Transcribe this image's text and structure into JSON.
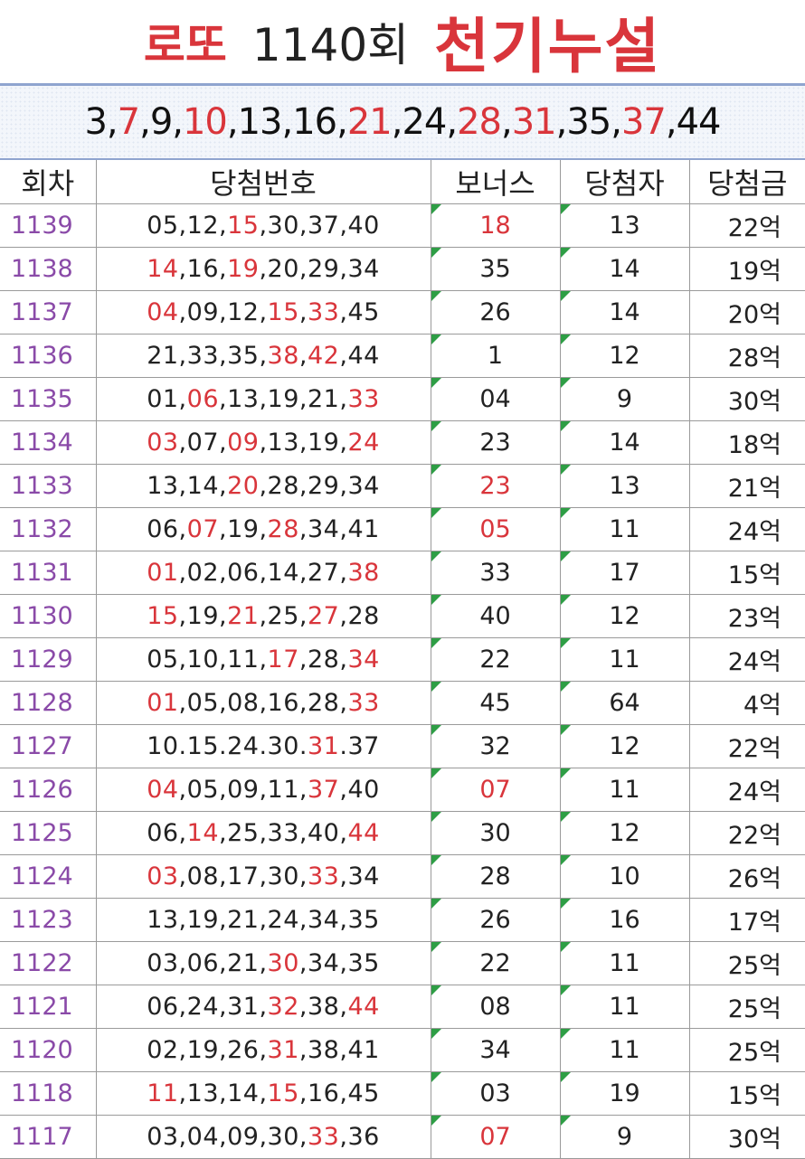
{
  "header": {
    "lotto_label": "로또",
    "round_label": "1140회",
    "secret_label": "천기누설"
  },
  "prediction": {
    "numbers": [
      {
        "n": "3",
        "hot": false
      },
      {
        "n": "7",
        "hot": true
      },
      {
        "n": "9",
        "hot": false
      },
      {
        "n": "10",
        "hot": true
      },
      {
        "n": "13",
        "hot": false
      },
      {
        "n": "16",
        "hot": false
      },
      {
        "n": "21",
        "hot": true
      },
      {
        "n": "24",
        "hot": false
      },
      {
        "n": "28",
        "hot": true
      },
      {
        "n": "31",
        "hot": true
      },
      {
        "n": "35",
        "hot": false
      },
      {
        "n": "37",
        "hot": true
      },
      {
        "n": "44",
        "hot": false
      }
    ],
    "separator": ","
  },
  "table": {
    "columns": [
      "회차",
      "당첨번호",
      "보너스",
      "당첨자",
      "당첨금"
    ],
    "colors": {
      "highlight": "#d9353b",
      "round": "#8a4aa8",
      "flag": "#2e9e45"
    },
    "rows": [
      {
        "round": "1139",
        "nums": [
          "05",
          "12",
          "15",
          "30",
          "37",
          "40"
        ],
        "hot": [
          2
        ],
        "sep": ",",
        "bonus": "18",
        "bonus_hot": true,
        "winners": "13",
        "prize": "22억"
      },
      {
        "round": "1138",
        "nums": [
          "14",
          "16",
          "19",
          "20",
          "29",
          "34"
        ],
        "hot": [
          0,
          2
        ],
        "sep": ",",
        "bonus": "35",
        "bonus_hot": false,
        "winners": "14",
        "prize": "19억"
      },
      {
        "round": "1137",
        "nums": [
          "04",
          "09",
          "12",
          "15",
          "33",
          "45"
        ],
        "hot": [
          0,
          3,
          4
        ],
        "sep": ",",
        "bonus": "26",
        "bonus_hot": false,
        "winners": "14",
        "prize": "20억"
      },
      {
        "round": "1136",
        "nums": [
          "21",
          "33",
          "35",
          "38",
          "42",
          "44"
        ],
        "hot": [
          3,
          4
        ],
        "sep": ",",
        "bonus": "1",
        "bonus_hot": false,
        "winners": "12",
        "prize": "28억"
      },
      {
        "round": "1135",
        "nums": [
          "01",
          "06",
          "13",
          "19",
          "21",
          "33"
        ],
        "hot": [
          1,
          5
        ],
        "sep": ",",
        "bonus": "04",
        "bonus_hot": false,
        "winners": "9",
        "prize": "30억"
      },
      {
        "round": "1134",
        "nums": [
          "03",
          "07",
          "09",
          "13",
          "19",
          "24"
        ],
        "hot": [
          0,
          2,
          5
        ],
        "sep": ",",
        "bonus": "23",
        "bonus_hot": false,
        "winners": "14",
        "prize": "18억"
      },
      {
        "round": "1133",
        "nums": [
          "13",
          "14",
          "20",
          "28",
          "29",
          "34"
        ],
        "hot": [
          2
        ],
        "sep": ",",
        "bonus": "23",
        "bonus_hot": true,
        "winners": "13",
        "prize": "21억"
      },
      {
        "round": "1132",
        "nums": [
          "06",
          "07",
          "19",
          "28",
          "34",
          "41"
        ],
        "hot": [
          1,
          3
        ],
        "sep": ",",
        "bonus": "05",
        "bonus_hot": true,
        "winners": "11",
        "prize": "24억"
      },
      {
        "round": "1131",
        "nums": [
          "01",
          "02",
          "06",
          "14",
          "27",
          "38"
        ],
        "hot": [
          0,
          5
        ],
        "sep": ",",
        "bonus": "33",
        "bonus_hot": false,
        "winners": "17",
        "prize": "15억"
      },
      {
        "round": "1130",
        "nums": [
          "15",
          "19",
          "21",
          "25",
          "27",
          "28"
        ],
        "hot": [
          0,
          2,
          4
        ],
        "sep": ",",
        "bonus": "40",
        "bonus_hot": false,
        "winners": "12",
        "prize": "23억"
      },
      {
        "round": "1129",
        "nums": [
          "05",
          "10",
          "11",
          "17",
          "28",
          "34"
        ],
        "hot": [
          3,
          5
        ],
        "sep": ",",
        "bonus": "22",
        "bonus_hot": false,
        "winners": "11",
        "prize": "24억"
      },
      {
        "round": "1128",
        "nums": [
          "01",
          "05",
          "08",
          "16",
          "28",
          "33"
        ],
        "hot": [
          0,
          5
        ],
        "sep": ",",
        "bonus": "45",
        "bonus_hot": false,
        "winners": "64",
        "prize": "4억"
      },
      {
        "round": "1127",
        "nums": [
          "10",
          "15",
          "24",
          "30",
          "31",
          "37"
        ],
        "hot": [
          4
        ],
        "sep": ".",
        "bonus": "32",
        "bonus_hot": false,
        "winners": "12",
        "prize": "22억"
      },
      {
        "round": "1126",
        "nums": [
          "04",
          "05",
          "09",
          "11",
          "37",
          "40"
        ],
        "hot": [
          0,
          4
        ],
        "sep": ",",
        "bonus": "07",
        "bonus_hot": true,
        "winners": "11",
        "prize": "24억"
      },
      {
        "round": "1125",
        "nums": [
          "06",
          "14",
          "25",
          "33",
          "40",
          "44"
        ],
        "hot": [
          1,
          5
        ],
        "sep": ",",
        "bonus": "30",
        "bonus_hot": false,
        "winners": "12",
        "prize": "22억"
      },
      {
        "round": "1124",
        "nums": [
          "03",
          "08",
          "17",
          "30",
          "33",
          "34"
        ],
        "hot": [
          0,
          4
        ],
        "sep": ",",
        "bonus": "28",
        "bonus_hot": false,
        "winners": "10",
        "prize": "26억"
      },
      {
        "round": "1123",
        "nums": [
          "13",
          "19",
          "21",
          "24",
          "34",
          "35"
        ],
        "hot": [],
        "sep": ",",
        "bonus": "26",
        "bonus_hot": false,
        "winners": "16",
        "prize": "17억"
      },
      {
        "round": "1122",
        "nums": [
          "03",
          "06",
          "21",
          "30",
          "34",
          "35"
        ],
        "hot": [
          3
        ],
        "sep": ",",
        "bonus": "22",
        "bonus_hot": false,
        "winners": "11",
        "prize": "25억"
      },
      {
        "round": "1121",
        "nums": [
          "06",
          "24",
          "31",
          "32",
          "38",
          "44"
        ],
        "hot": [
          3,
          5
        ],
        "sep": ",",
        "bonus": "08",
        "bonus_hot": false,
        "winners": "11",
        "prize": "25억"
      },
      {
        "round": "1120",
        "nums": [
          "02",
          "19",
          "26",
          "31",
          "38",
          "41"
        ],
        "hot": [
          3
        ],
        "sep": ",",
        "bonus": "34",
        "bonus_hot": false,
        "winners": "11",
        "prize": "25억"
      },
      {
        "round": "1118",
        "nums": [
          "11",
          "13",
          "14",
          "15",
          "16",
          "45"
        ],
        "hot": [
          0,
          3
        ],
        "sep": ",",
        "bonus": "03",
        "bonus_hot": false,
        "winners": "19",
        "prize": "15억"
      },
      {
        "round": "1117",
        "nums": [
          "03",
          "04",
          "09",
          "30",
          "33",
          "36"
        ],
        "hot": [
          4
        ],
        "sep": ",",
        "bonus": "07",
        "bonus_hot": true,
        "winners": "9",
        "prize": "30억"
      }
    ]
  }
}
